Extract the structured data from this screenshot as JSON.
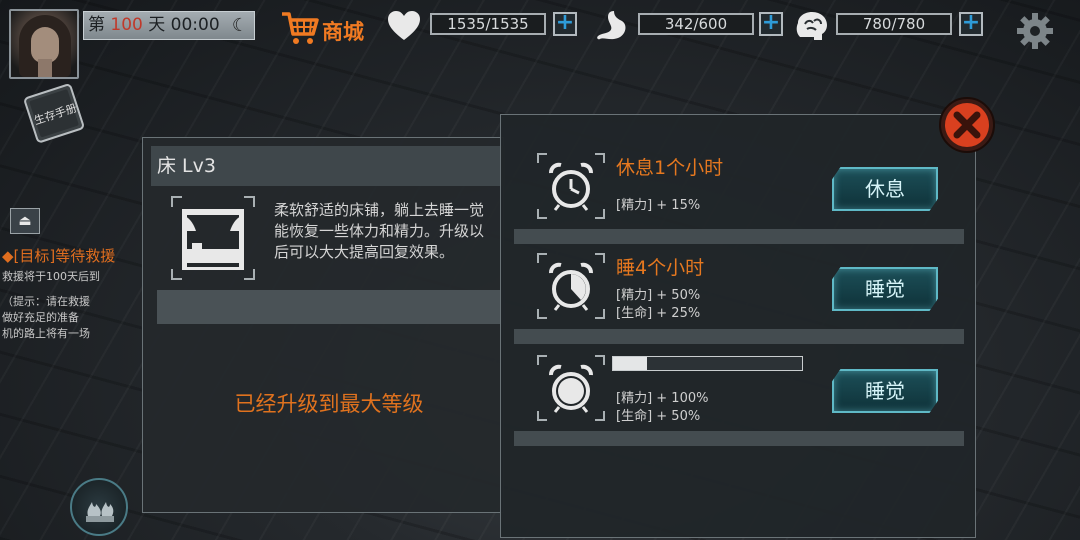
{
  "topbar": {
    "day_prefix": "第 ",
    "day_number": "100",
    "day_suffix": " 天",
    "time": "00:00",
    "shop_label": "商城",
    "health": {
      "value": "1535/1535",
      "icon": "heart-icon"
    },
    "hunger": {
      "value": "342/600",
      "icon": "stomach-icon"
    },
    "mind": {
      "value": "780/780",
      "icon": "brain-icon"
    },
    "plus_label": "+",
    "moon_icon": "crescent-moon-icon",
    "settings_icon": "gear-icon"
  },
  "hud": {
    "manual_label": "生存手册",
    "eject_label": "⏏",
    "objective_title": "◆[目标]等待救援",
    "objective_line": "救援将于100天后到",
    "hint_lines": [
      "（提示：请在救援",
      "做好充足的准备",
      "机的路上将有一场"
    ]
  },
  "bed": {
    "title": "床 Lv3",
    "description": "柔软舒适的床铺，躺上去睡一觉能恢复一些体力和精力。升级以后可以大大提高回复效果。",
    "max_level_text": "已经升级到最大等级"
  },
  "options": [
    {
      "name": "休息1个小时",
      "effects": [
        "[精力] + 15%"
      ],
      "button": "休息"
    },
    {
      "name": "睡4个小时",
      "effects": [
        "[精力] + 50%",
        "[生命] + 25%"
      ],
      "button": "睡觉"
    },
    {
      "name": "",
      "effects": [
        "[精力] + 100%",
        "[生命] + 50%"
      ],
      "button": "睡觉",
      "progress": 0.18
    }
  ],
  "colors": {
    "accent_orange": "#e6781f",
    "button_cyan": "#5fb9c6",
    "close_red": "#d9401f"
  }
}
